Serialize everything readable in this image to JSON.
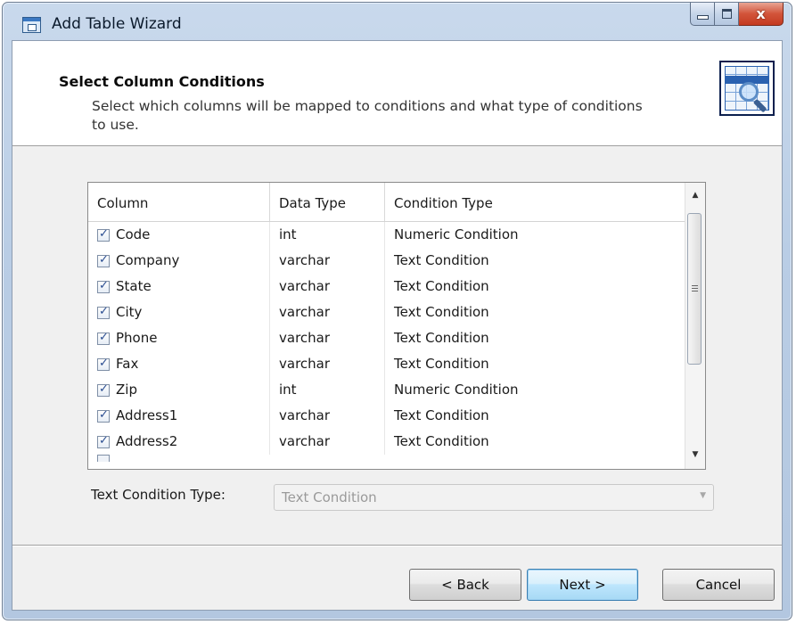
{
  "window": {
    "title": "Add Table Wizard",
    "close_glyph": "x"
  },
  "header": {
    "title": "Select Column Conditions",
    "description": "Select which columns will be mapped to conditions and what type of conditions to use.",
    "image_icon": "table-search-icon"
  },
  "grid": {
    "columns": [
      "Column",
      "Data Type",
      "Condition Type"
    ],
    "rows": [
      {
        "checked": true,
        "column": "Code",
        "data_type": "int",
        "condition_type": "Numeric Condition"
      },
      {
        "checked": true,
        "column": "Company",
        "data_type": "varchar",
        "condition_type": "Text Condition"
      },
      {
        "checked": true,
        "column": "State",
        "data_type": "varchar",
        "condition_type": "Text Condition"
      },
      {
        "checked": true,
        "column": "City",
        "data_type": "varchar",
        "condition_type": "Text Condition"
      },
      {
        "checked": true,
        "column": "Phone",
        "data_type": "varchar",
        "condition_type": "Text Condition"
      },
      {
        "checked": true,
        "column": "Fax",
        "data_type": "varchar",
        "condition_type": "Text Condition"
      },
      {
        "checked": true,
        "column": "Zip",
        "data_type": "int",
        "condition_type": "Numeric Condition"
      },
      {
        "checked": true,
        "column": "Address1",
        "data_type": "varchar",
        "condition_type": "Text Condition"
      },
      {
        "checked": true,
        "column": "Address2",
        "data_type": "varchar",
        "condition_type": "Text Condition"
      }
    ]
  },
  "text_condition_type": {
    "label": "Text Condition Type:",
    "value": "Text Condition",
    "enabled": false
  },
  "buttons": {
    "back": "< Back",
    "next": "Next >",
    "cancel": "Cancel"
  }
}
